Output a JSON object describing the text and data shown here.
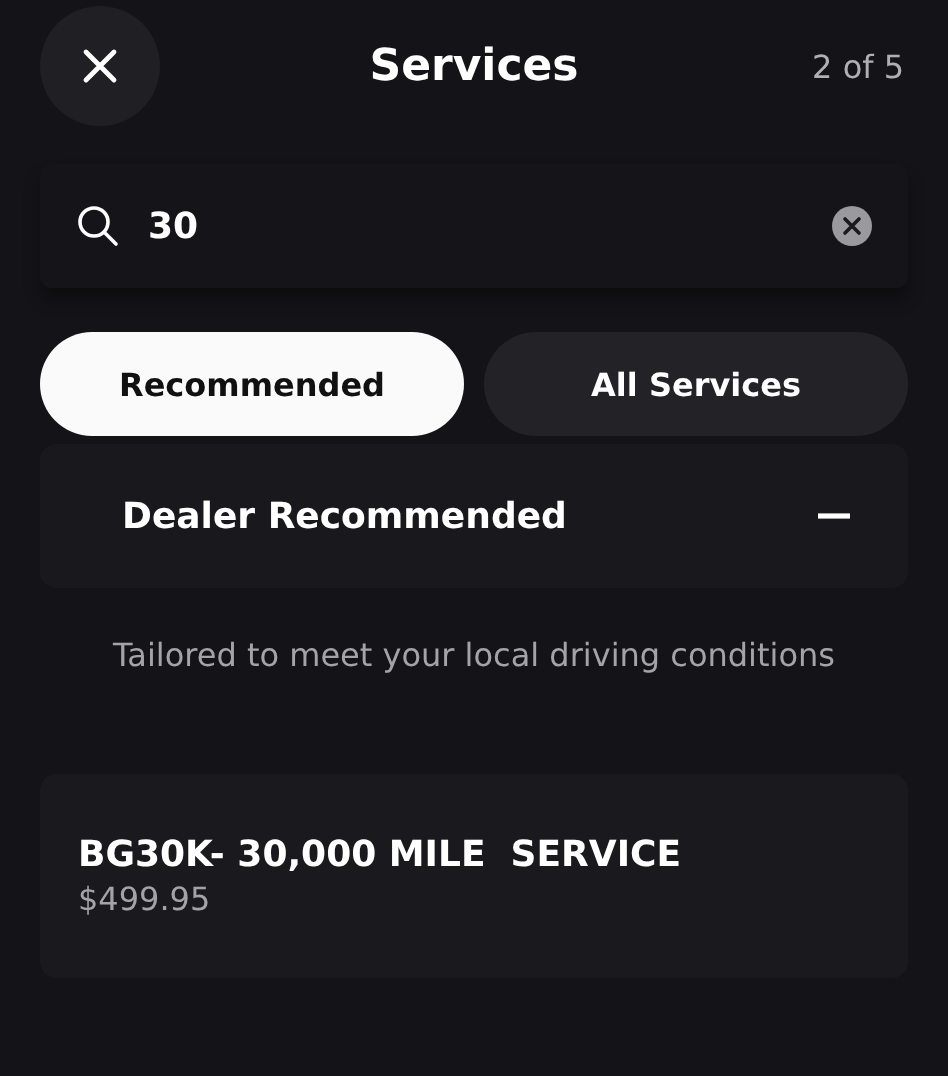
{
  "header": {
    "title": "Services",
    "counter": "2 of 5"
  },
  "search": {
    "value": "30"
  },
  "tabs": [
    {
      "label": "Recommended",
      "selected": true
    },
    {
      "label": "All Services",
      "selected": false
    }
  ],
  "section": {
    "title": "Dealer Recommended",
    "expanded": true,
    "subtitle": "Tailored to meet your local driving conditions"
  },
  "services": [
    {
      "name": "BG30K- 30,000 MILE  SERVICE",
      "price": "$499.95"
    }
  ]
}
